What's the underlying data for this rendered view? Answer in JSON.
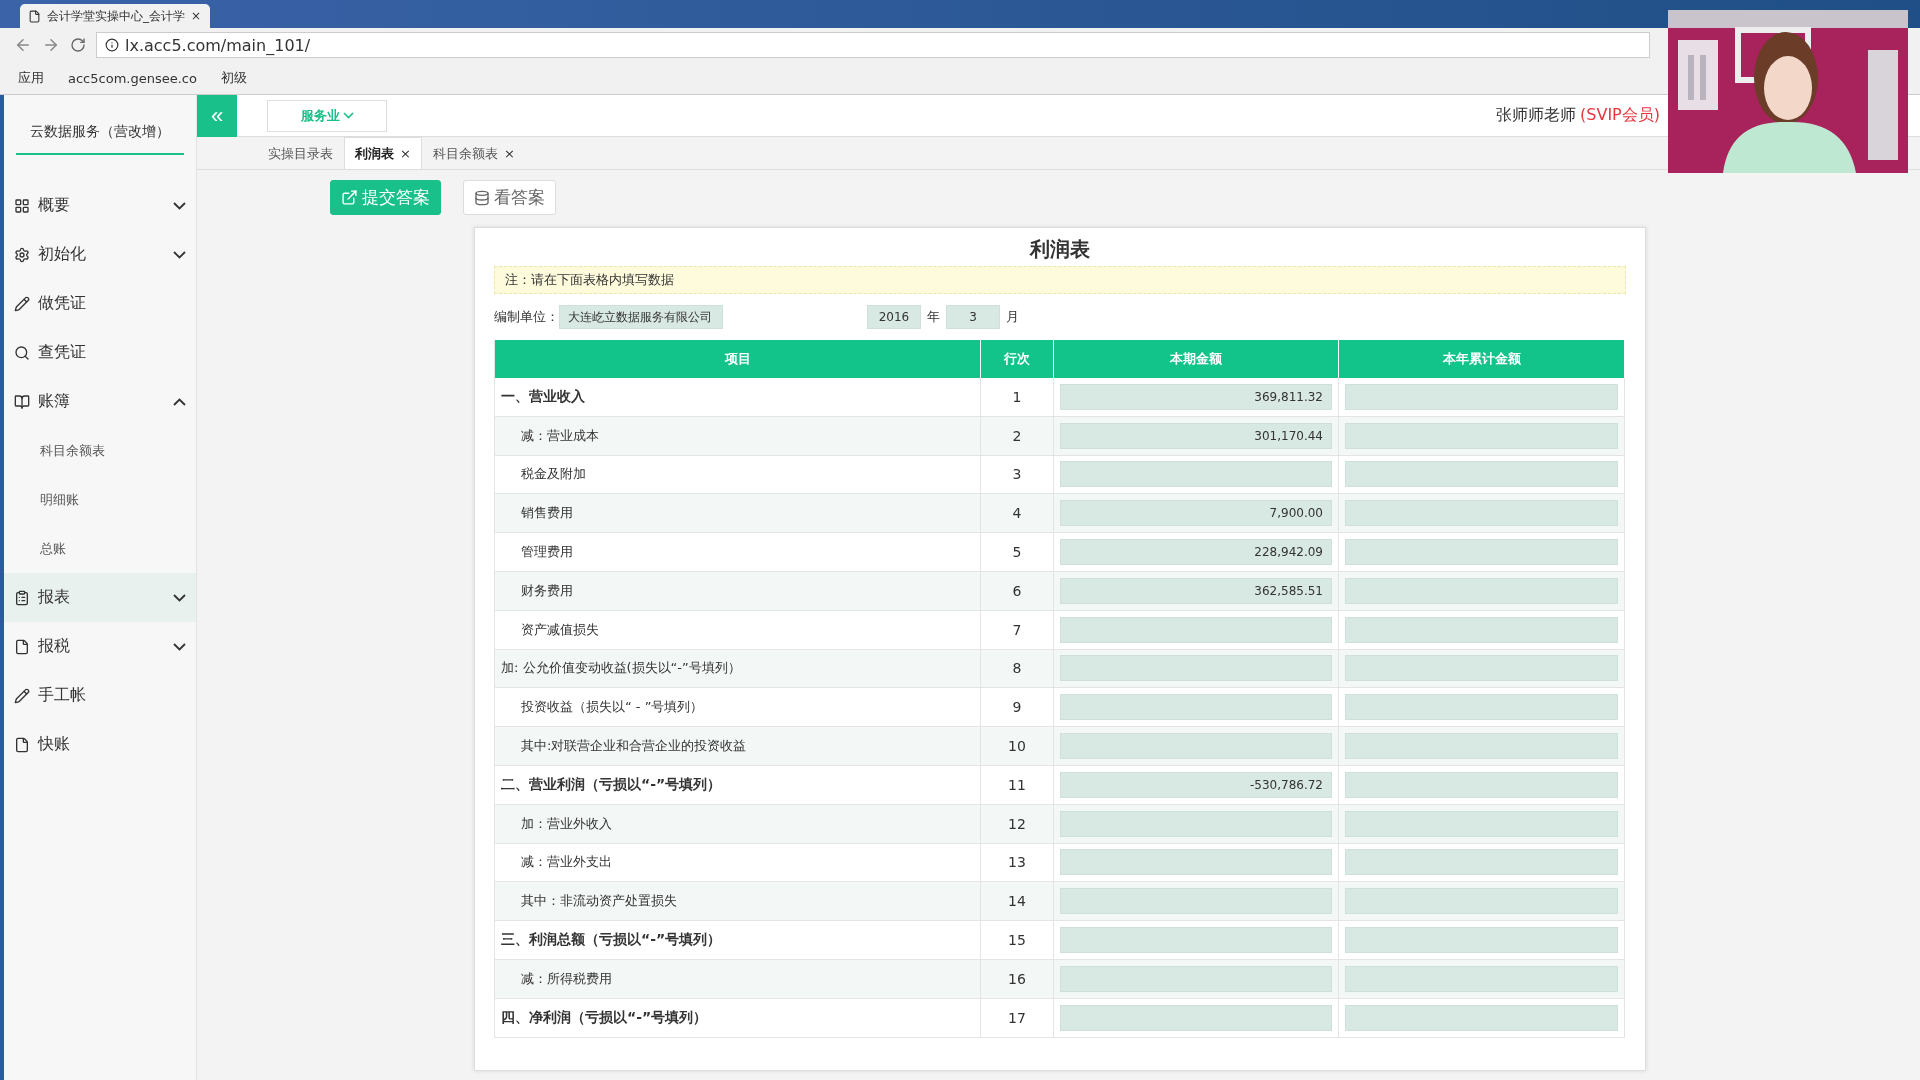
{
  "browser": {
    "tab_title": "会计学堂实操中心_会计学",
    "tab_close": "×",
    "address": "lx.acc5.com/main_101/",
    "bookmarks": [
      "应用",
      "acc5com.gensee.co",
      "初级"
    ]
  },
  "sidebar": {
    "title": "云数据服务（营改增）",
    "items": [
      {
        "label": "概要",
        "kind": "group",
        "expanded": false,
        "selected": false
      },
      {
        "label": "初始化",
        "kind": "group",
        "expanded": false,
        "selected": false
      },
      {
        "label": "做凭证",
        "kind": "link",
        "selected": false
      },
      {
        "label": "查凭证",
        "kind": "link",
        "selected": false
      },
      {
        "label": "账簿",
        "kind": "group",
        "expanded": true,
        "selected": false,
        "children": [
          {
            "label": "科目余额表",
            "selected": false
          },
          {
            "label": "明细账",
            "selected": false
          },
          {
            "label": "总账",
            "selected": false
          }
        ]
      },
      {
        "label": "报表",
        "kind": "group",
        "expanded": false,
        "selected": true
      },
      {
        "label": "报税",
        "kind": "group",
        "expanded": false,
        "selected": false
      },
      {
        "label": "手工帐",
        "kind": "link",
        "selected": false
      },
      {
        "label": "快账",
        "kind": "link",
        "selected": false
      }
    ]
  },
  "header": {
    "collapse": "«",
    "industry": "服务业",
    "user": "张师师老师",
    "membership": "(SVIP会员)"
  },
  "tabs": [
    {
      "label": "实操目录表",
      "selected": false
    },
    {
      "label": "利润表",
      "selected": true,
      "close": "×"
    },
    {
      "label": "科目余额表",
      "selected": false,
      "close": "×"
    }
  ],
  "actions": [
    {
      "label": "提交答案",
      "kind": "primary"
    },
    {
      "label": "看答案",
      "kind": "secondary"
    }
  ],
  "report": {
    "title": "利润表",
    "note": "注：请在下面表格内填写数据",
    "unit_label": "编制单位：",
    "unit": "大连屹立数据服务有限公司",
    "year": "2016",
    "year_label": "年",
    "month": "3",
    "month_label": "月",
    "columns": [
      "项目",
      "行次",
      "本期金额",
      "本年累计金额"
    ],
    "rows": [
      {
        "label": "一、营业收入",
        "kind": "section",
        "line": "1",
        "current": "369,811.32"
      },
      {
        "label": "减：营业成本",
        "kind": "item",
        "line": "2",
        "current": "301,170.44"
      },
      {
        "label": "税金及附加",
        "kind": "item",
        "line": "3"
      },
      {
        "label": "销售费用",
        "kind": "item",
        "line": "4",
        "current": "7,900.00"
      },
      {
        "label": "管理费用",
        "kind": "item",
        "line": "5",
        "current": "228,942.09"
      },
      {
        "label": "财务费用",
        "kind": "item",
        "line": "6",
        "current": "362,585.51"
      },
      {
        "label": "资产减值损失",
        "kind": "item",
        "line": "7"
      },
      {
        "label": "加: 公允价值变动收益(损失以“-”号填列）",
        "kind": "plain",
        "line": "8"
      },
      {
        "label": "投资收益（损失以“ - ”号填列）",
        "kind": "item",
        "line": "9"
      },
      {
        "label": "其中:对联营企业和合营企业的投资收益",
        "kind": "item",
        "line": "10"
      },
      {
        "label": "二、营业利润（亏损以“-”号填列）",
        "kind": "section",
        "line": "11",
        "current": "-530,786.72"
      },
      {
        "label": "加：营业外收入",
        "kind": "item",
        "line": "12"
      },
      {
        "label": "减：营业外支出",
        "kind": "item",
        "line": "13"
      },
      {
        "label": "其中：非流动资产处置损失",
        "kind": "item",
        "line": "14"
      },
      {
        "label": "三、利润总额（亏损以“-”号填列）",
        "kind": "section",
        "line": "15"
      },
      {
        "label": "减：所得税费用",
        "kind": "item",
        "line": "16"
      },
      {
        "label": "四、净利润（亏损以“-”号填列）",
        "kind": "section",
        "line": "17"
      }
    ]
  }
}
